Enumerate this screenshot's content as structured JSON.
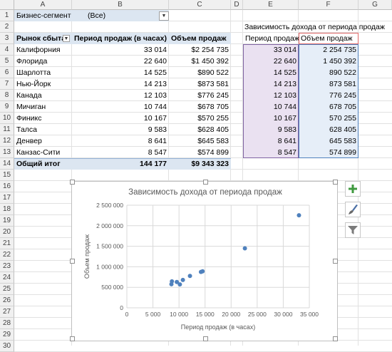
{
  "columns": [
    "A",
    "B",
    "C",
    "D",
    "E",
    "F",
    "G"
  ],
  "rows": [
    "1",
    "2",
    "3",
    "4",
    "5",
    "6",
    "7",
    "8",
    "9",
    "10",
    "11",
    "12",
    "13",
    "14",
    "15",
    "16",
    "17",
    "18",
    "19",
    "20",
    "21",
    "22",
    "23",
    "24",
    "25",
    "26",
    "27",
    "28",
    "29",
    "30"
  ],
  "filter": {
    "label": "Бизнес-сегмент",
    "value": "(Все)"
  },
  "pivot": {
    "headers": [
      "Рынок сбыта",
      "Период продаж (в часах)",
      "Объем продаж"
    ],
    "rows": [
      [
        "Калифорния",
        "33 014",
        "$2 254 735"
      ],
      [
        "Флорида",
        "22 640",
        "$1 450 392"
      ],
      [
        "Шарлотта",
        "14 525",
        "$890 522"
      ],
      [
        "Нью-Йорк",
        "14 213",
        "$873 581"
      ],
      [
        "Канада",
        "12 103",
        "$776 245"
      ],
      [
        "Мичиган",
        "10 744",
        "$678 705"
      ],
      [
        "Финикс",
        "10 167",
        "$570 255"
      ],
      [
        "Талса",
        "9 583",
        "$628 405"
      ],
      [
        "Денвер",
        "8 641",
        "$645 583"
      ],
      [
        "Канзас-Сити",
        "8 547",
        "$574 899"
      ]
    ],
    "total": [
      "Общий итог",
      "144 177",
      "$9 343 323"
    ]
  },
  "side_table": {
    "title": "Зависимость дохода от периода продаж",
    "headers": [
      "Период продаж",
      "Объем продаж"
    ],
    "rows": [
      [
        "33 014",
        "2 254 735"
      ],
      [
        "22 640",
        "1 450 392"
      ],
      [
        "14 525",
        "890 522"
      ],
      [
        "14 213",
        "873 581"
      ],
      [
        "12 103",
        "776 245"
      ],
      [
        "10 744",
        "678 705"
      ],
      [
        "10 167",
        "570 255"
      ],
      [
        "9 583",
        "628 405"
      ],
      [
        "8 641",
        "645 583"
      ],
      [
        "8 547",
        "574 899"
      ]
    ]
  },
  "chart_data": {
    "type": "scatter",
    "title": "Зависимость дохода от периода продаж",
    "xlabel": "Период продаж (в часах)",
    "ylabel": "Объем продаж",
    "xlim": [
      0,
      35000
    ],
    "ylim": [
      0,
      2500000
    ],
    "xticks": [
      "0",
      "5 000",
      "10 000",
      "15 000",
      "20 000",
      "25 000",
      "30 000",
      "35 000"
    ],
    "yticks": [
      "0",
      "500 000",
      "1 000 000",
      "1 500 000",
      "2 000 000",
      "2 500 000"
    ],
    "series": [
      {
        "x": [
          33014,
          22640,
          14525,
          14213,
          12103,
          10744,
          10167,
          9583,
          8641,
          8547
        ],
        "y": [
          2254735,
          1450392,
          890522,
          873581,
          776245,
          678705,
          570255,
          628405,
          645583,
          574899
        ]
      }
    ],
    "grid": true,
    "point_color": "#4f81bd"
  },
  "chart_tools": {
    "add": "chart-elements",
    "style": "chart-styles",
    "filter": "chart-filters"
  }
}
